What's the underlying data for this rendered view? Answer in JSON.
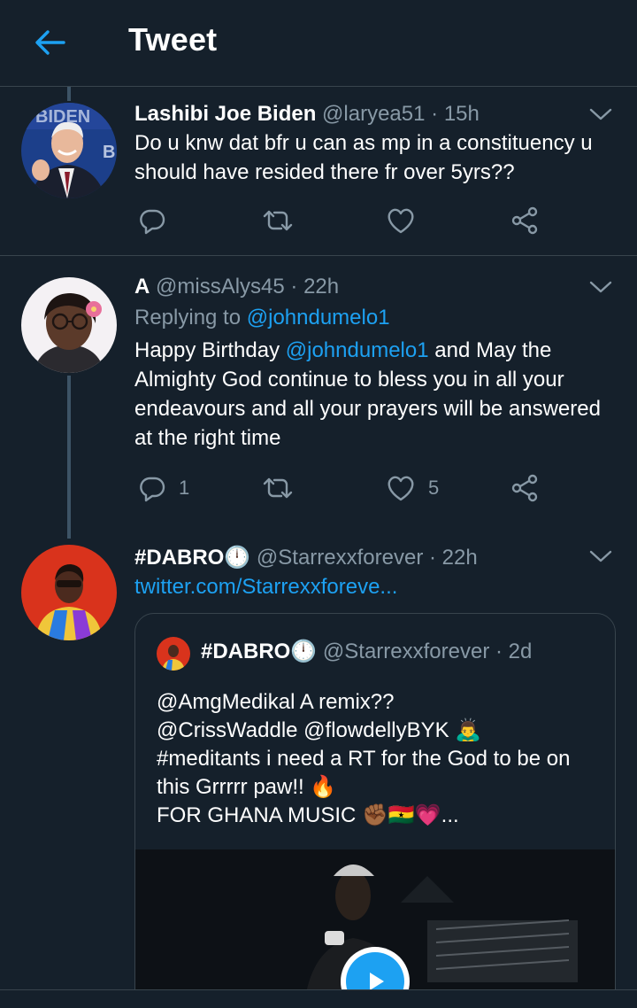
{
  "header": {
    "title": "Tweet"
  },
  "colors": {
    "background": "#15202b",
    "accent": "#1da1f2",
    "muted": "#8899a6",
    "divider": "#38444d"
  },
  "tweets": [
    {
      "name": "Lashibi Joe Biden",
      "handle": "@laryea51",
      "time": "· 15h",
      "text": "Do u knw dat bfr u can as mp in a constituency u should have resided there fr over 5yrs??",
      "actions": {
        "reply_count": "",
        "retweet_count": "",
        "like_count": ""
      }
    },
    {
      "name": "A",
      "handle": "@missAlys45",
      "time": "· 22h",
      "replying_label": "Replying to",
      "replying_to": "@johndumelo1",
      "text_prefix": "Happy Birthday",
      "mention": "@johndumelo1",
      "text_suffix": "and May the Almighty God continue to bless you in all your endeavours and all your prayers will be answered at the right time",
      "actions": {
        "reply_count": "1",
        "retweet_count": "",
        "like_count": "5"
      }
    },
    {
      "name": "#DABRO",
      "name_emoji": "🕛",
      "handle": "@Starrexxforever",
      "time": "· 22h",
      "link": "twitter.com/Starrexxforeve...",
      "quote": {
        "name": "#DABRO",
        "name_emoji": "🕛",
        "handle": "@Starrexxforever",
        "time": "· 2d",
        "lines": [
          "@AmgMedikal A remix??",
          "@CrissWaddle  @flowdellyBYK 🙇‍♂",
          "#meditants i need a RT for the God to be on",
          "this Grrrrr paw!! 🔥",
          "FOR GHANA MUSIC ✊🏾🇬🇭💗..."
        ]
      }
    }
  ]
}
